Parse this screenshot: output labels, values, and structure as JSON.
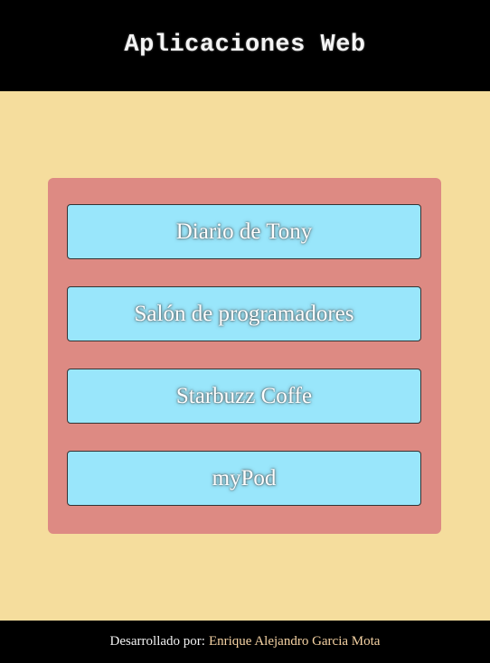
{
  "header": {
    "title": "Aplicaciones Web"
  },
  "apps": [
    {
      "label": "Diario de Tony"
    },
    {
      "label": "Salón de programadores"
    },
    {
      "label": "Starbuzz Coffe"
    },
    {
      "label": "myPod"
    }
  ],
  "footer": {
    "label": "Desarrollado por:",
    "author": "Enrique Alejandro Garcia Mota"
  },
  "colors": {
    "background": "#f5dd9d",
    "header_footer": "#000000",
    "panel": "#dd8a83",
    "link_button": "#99e6fb",
    "author_text": "#f6d3a4"
  }
}
